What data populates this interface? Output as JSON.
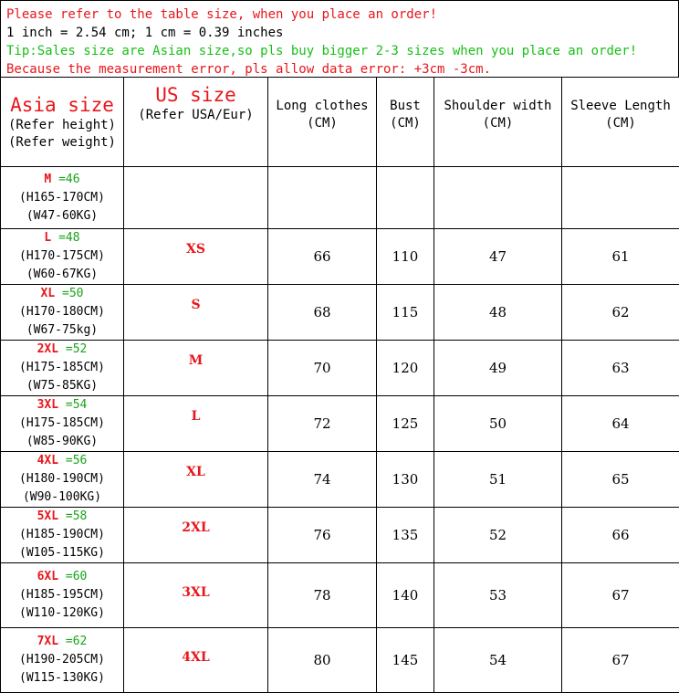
{
  "notes": {
    "line1": "Please refer to the table size, when you place an order!",
    "line2": "1 inch = 2.54 cm; 1 cm = 0.39 inches",
    "line3": "Tip:Sales size are Asian size,so pls buy bigger 2-3 sizes when you place an order!",
    "line4": "Because the measurement error, pls allow data error: +3cm -3cm."
  },
  "header": {
    "asia_title": "Asia size",
    "asia_sub1": "(Refer height)",
    "asia_sub2": "(Refer weight)",
    "us_title": "US size",
    "us_sub": "(Refer USA/Eur)",
    "long_clothes": "Long clothes",
    "long_unit": "(CM)",
    "bust": "Bust",
    "bust_unit": "(CM)",
    "shoulder": "Shoulder width",
    "shoulder_unit": "(CM)",
    "sleeve": "Sleeve Length",
    "sleeve_unit": "(CM)"
  },
  "rows": [
    {
      "size": "M",
      "eq": " =46",
      "height": "(H165-170CM)",
      "weight": "(W47-60KG)",
      "us": "",
      "long": "",
      "bust": "",
      "shoulder": "",
      "sleeve": ""
    },
    {
      "size": "L",
      "eq": " =48",
      "height": "(H170-175CM)",
      "weight": "(W60-67KG)",
      "us": "XS",
      "long": "66",
      "bust": "110",
      "shoulder": "47",
      "sleeve": "61"
    },
    {
      "size": "XL",
      "eq": " =50",
      "height": "(H170-180CM)",
      "weight": "(W67-75kg)",
      "us": "S",
      "long": "68",
      "bust": "115",
      "shoulder": "48",
      "sleeve": "62"
    },
    {
      "size": "2XL",
      "eq": " =52",
      "height": "(H175-185CM)",
      "weight": "(W75-85KG)",
      "us": "M",
      "long": "70",
      "bust": "120",
      "shoulder": "49",
      "sleeve": "63"
    },
    {
      "size": "3XL",
      "eq": " =54",
      "height": "(H175-185CM)",
      "weight": "(W85-90KG)",
      "us": "L",
      "long": "72",
      "bust": "125",
      "shoulder": "50",
      "sleeve": "64"
    },
    {
      "size": "4XL",
      "eq": " =56",
      "height": "(H180-190CM)",
      "weight": "(W90-100KG)",
      "us": "XL",
      "long": "74",
      "bust": "130",
      "shoulder": "51",
      "sleeve": "65"
    },
    {
      "size": "5XL",
      "eq": " =58",
      "height": "(H185-190CM)",
      "weight": "(W105-115KG)",
      "us": "2XL",
      "long": "76",
      "bust": "135",
      "shoulder": "52",
      "sleeve": "66"
    },
    {
      "size": "6XL",
      "eq": " =60",
      "height": "(H185-195CM)",
      "weight": "(W110-120KG)",
      "us": "3XL",
      "long": "78",
      "bust": "140",
      "shoulder": "53",
      "sleeve": "67"
    },
    {
      "size": "7XL",
      "eq": " =62",
      "height": "(H190-205CM)",
      "weight": "(W115-130KG)",
      "us": "4XL",
      "long": "80",
      "bust": "145",
      "shoulder": "54",
      "sleeve": "67"
    }
  ],
  "colors": {
    "red": "#e8161b",
    "green": "#17c017",
    "black": "#000000"
  }
}
